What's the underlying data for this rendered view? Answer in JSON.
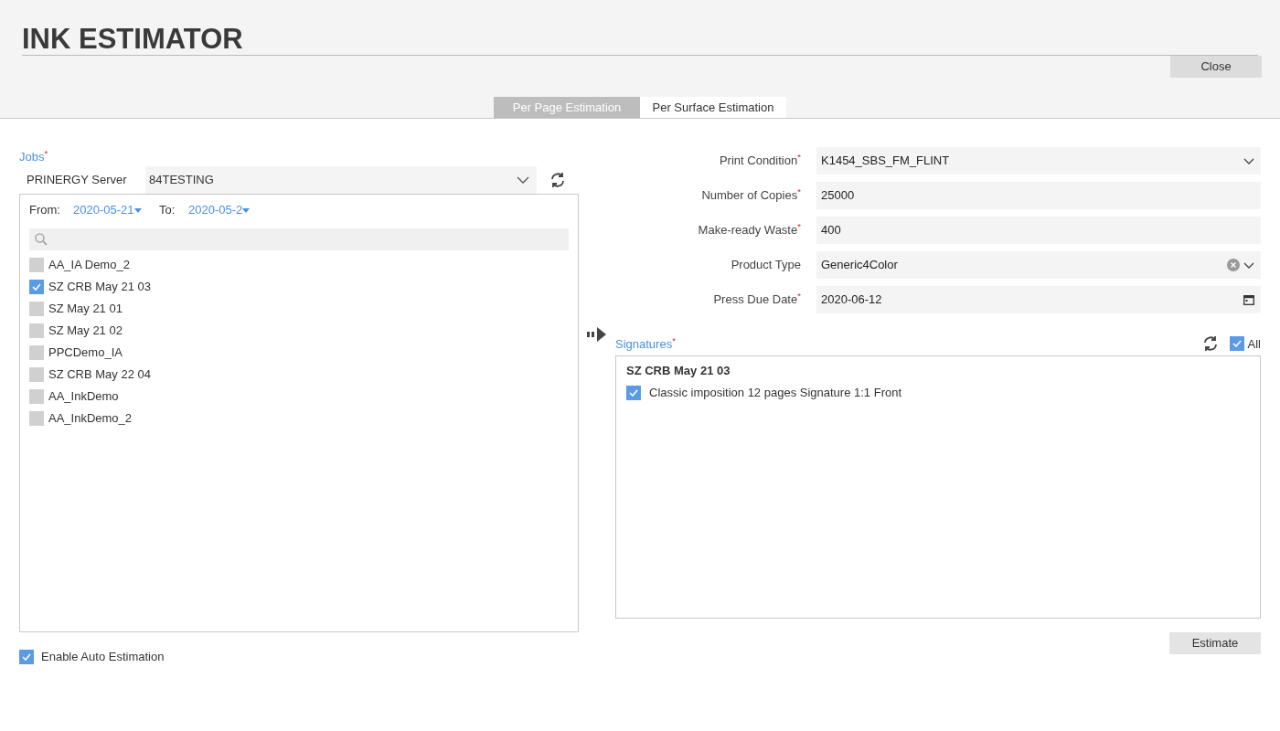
{
  "header": {
    "title": "INK ESTIMATOR",
    "close_button": "Close"
  },
  "tabs": [
    {
      "label": "Per Page Estimation",
      "selected": false
    },
    {
      "label": "Per Surface Estimation",
      "selected": true
    }
  ],
  "jobs": {
    "label": "Jobs",
    "required_mark": "*",
    "server_label": "PRINERGY Server",
    "server_value": "84TESTING",
    "from_label": "From:",
    "from_value": "2020-05-21",
    "to_label": "To:",
    "to_value": "2020-05-2",
    "items": [
      {
        "label": "AA_IA Demo_2",
        "checked": false
      },
      {
        "label": "SZ CRB May 21 03",
        "checked": true
      },
      {
        "label": "SZ May 21 01",
        "checked": false
      },
      {
        "label": "SZ May 21 02",
        "checked": false
      },
      {
        "label": "PPCDemo_IA",
        "checked": false
      },
      {
        "label": "SZ CRB May 22 04",
        "checked": false
      },
      {
        "label": "AA_InkDemo",
        "checked": false
      },
      {
        "label": "AA_InkDemo_2",
        "checked": false
      }
    ]
  },
  "form": [
    {
      "label": "Print Condition",
      "required_mark": "*",
      "kind": "select",
      "value": "K1454_SBS_FM_FLINT",
      "clearable": false
    },
    {
      "label": "Number of Copies",
      "required_mark": "*",
      "kind": "text",
      "value": "25000",
      "clearable": false
    },
    {
      "label": "Make-ready Waste",
      "required_mark": "*",
      "kind": "text",
      "value": "400",
      "clearable": false
    },
    {
      "label": "Product Type",
      "kind": "select",
      "value": "Generic4Color",
      "clearable": true
    },
    {
      "label": "Press Due Date",
      "required_mark": "*",
      "kind": "date",
      "value": "2020-06-12",
      "clearable": false
    }
  ],
  "signatures": {
    "label": "Signatures",
    "required_mark": "*",
    "all_label": "All",
    "all_checked": true,
    "groups": [
      {
        "title": "SZ CRB May 21 03",
        "items": [
          {
            "label": "Classic imposition 12 pages Signature 1:1 Front",
            "checked": true
          }
        ]
      }
    ]
  },
  "auto_estimation": {
    "label": "Enable Auto Estimation",
    "checked": true
  },
  "estimate_button": "Estimate"
}
